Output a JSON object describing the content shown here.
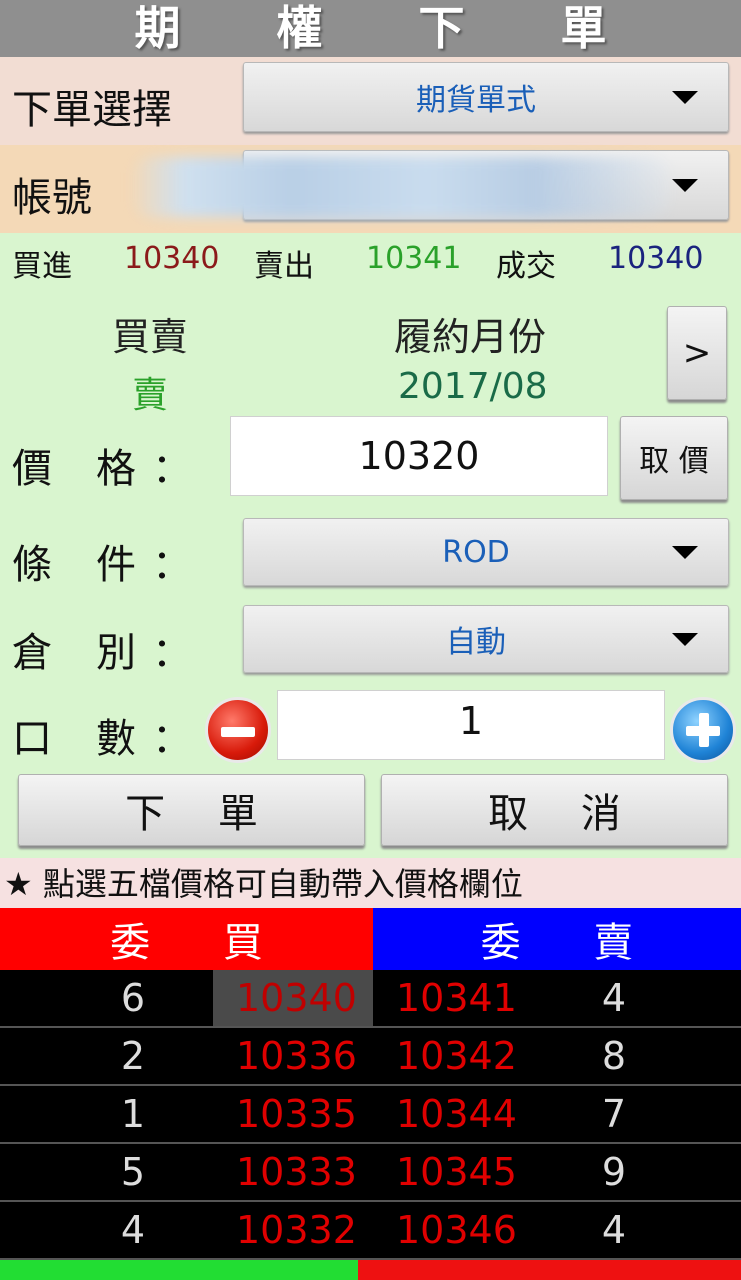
{
  "header": {
    "title": "期 權 下 單"
  },
  "order_type": {
    "label": "下單選擇",
    "value": "期貨單式",
    "arrow_icon": "chevron-down-icon"
  },
  "account": {
    "label": "帳號",
    "value": "",
    "arrow_icon": "chevron-down-icon"
  },
  "quote": {
    "bid_label": "買進",
    "bid_value": "10340",
    "ask_label": "賣出",
    "ask_value": "10341",
    "last_label": "成交",
    "last_value": "10340"
  },
  "trade": {
    "side_label": "買賣",
    "side_value": "賣",
    "month_label": "履約月份",
    "month_value": "2017/08",
    "next_button": ">"
  },
  "price": {
    "label_1": "價",
    "label_2": "格",
    "colon": "：",
    "value": "10320",
    "fetch_button": "取 價"
  },
  "condition": {
    "label_1": "條",
    "label_2": "件",
    "colon": "：",
    "value": "ROD"
  },
  "position": {
    "label_1": "倉",
    "label_2": "別",
    "colon": "：",
    "value": "自動"
  },
  "quantity": {
    "label_1": "口",
    "label_2": "數",
    "colon": "：",
    "value": "1",
    "minus_icon": "minus-circle-icon",
    "plus_icon": "plus-circle-icon"
  },
  "actions": {
    "submit": "下 單",
    "cancel": "取 消"
  },
  "hint": "★ 點選五檔價格可自動帶入價格欄位",
  "book": {
    "bid_header": "委 買",
    "ask_header": "委 賣",
    "rows": [
      {
        "bid_qty": "6",
        "bid_price": "10340",
        "ask_price": "10341",
        "ask_qty": "4"
      },
      {
        "bid_qty": "2",
        "bid_price": "10336",
        "ask_price": "10342",
        "ask_qty": "8"
      },
      {
        "bid_qty": "1",
        "bid_price": "10335",
        "ask_price": "10344",
        "ask_qty": "7"
      },
      {
        "bid_qty": "5",
        "bid_price": "10333",
        "ask_price": "10345",
        "ask_qty": "9"
      },
      {
        "bid_qty": "4",
        "bid_price": "10332",
        "ask_price": "10346",
        "ask_qty": "4"
      }
    ]
  },
  "colors": {
    "bid_header_bg": "#ff0000",
    "ask_header_bg": "#0000ff",
    "bid_value": "#8b1a1a",
    "ask_value": "#2aa12a",
    "last_value": "#1a237e",
    "book_price": "#e00000",
    "dropdown_text": "#1a5fb8"
  }
}
